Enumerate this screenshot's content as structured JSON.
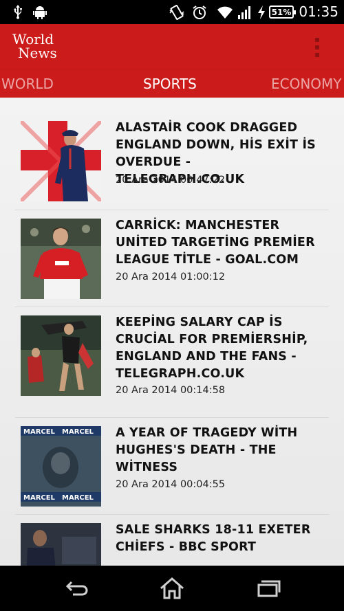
{
  "status_bar": {
    "time": "01:35",
    "battery": "51%",
    "icons": [
      "usb-icon",
      "android-icon",
      "vibrate-icon",
      "alarm-icon",
      "wifi-icon",
      "signal-icon",
      "charging-icon",
      "battery-icon"
    ]
  },
  "app_bar": {
    "logo_line1": "World",
    "logo_line2": "News",
    "menu_icon": "overflow-menu-icon",
    "color": "#cc1b1b"
  },
  "tabs": [
    {
      "label": "WORLD",
      "active": false
    },
    {
      "label": "SPORTS",
      "active": true
    },
    {
      "label": "ECONOMY",
      "active": false
    }
  ],
  "articles": [
    {
      "title": "ALASTAİR COOK DRAGGED ENGLAND DOWN, HİS EXİT İS OVERDUE - TELEGRAPH.CO.UK",
      "date": "20 Ara 2014 00:47:22"
    },
    {
      "title": "CARRİCK: MANCHESTER UNİTED TARGETİNG PREMİER LEAGUE TİTLE - GOAL.COM",
      "date": "20 Ara 2014 01:00:12"
    },
    {
      "title": "KEEPİNG SALARY CAP İS CRUCİAL FOR PREMİERSHİP, ENGLAND AND THE FANS - TELEGRAPH.CO.UK",
      "date": "20 Ara 2014 00:14:58"
    },
    {
      "title": "A YEAR OF TRAGEDY WİTH HUGHES'S DEATH - THE WİTNESS",
      "date": "20 Ara 2014 00:04:55"
    },
    {
      "title": "SALE SHARKS 18-11 EXETER CHİEFS - BBC SPORT",
      "date": ""
    }
  ],
  "thumb4_banner": "MARCEL",
  "nav_bar": {
    "icons": [
      "back-icon",
      "home-icon",
      "recent-apps-icon"
    ]
  }
}
